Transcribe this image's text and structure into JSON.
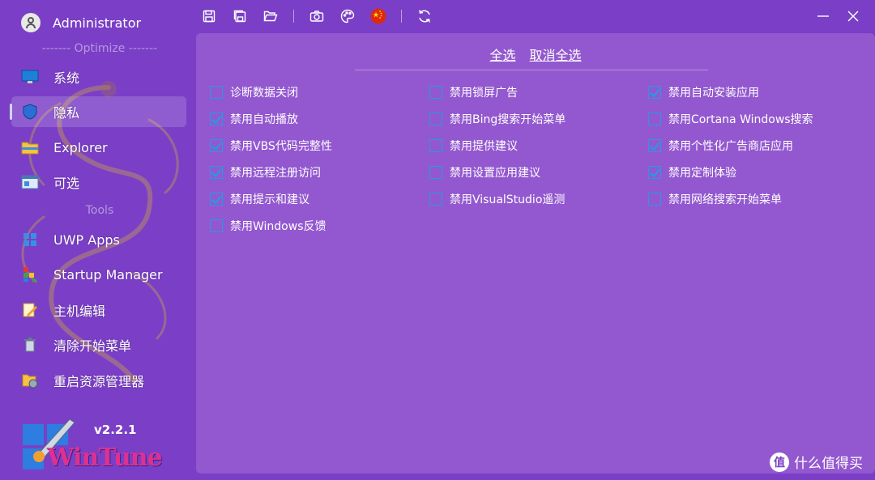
{
  "user": {
    "name": "Administrator"
  },
  "sections": {
    "optimize": "------- Optimize -------",
    "tools": "Tools"
  },
  "nav": [
    {
      "label": "系统",
      "icon": "monitor-icon"
    },
    {
      "label": "隐私",
      "icon": "shield-icon",
      "active": true
    },
    {
      "label": "Explorer",
      "icon": "folder-icon"
    },
    {
      "label": "可选",
      "icon": "window-icon"
    },
    {
      "label": "UWP Apps",
      "icon": "windows-icon"
    },
    {
      "label": "Startup Manager",
      "icon": "startup-icon"
    },
    {
      "label": "主机编辑",
      "icon": "edit-icon"
    },
    {
      "label": "清除开始菜单",
      "icon": "bin-icon"
    },
    {
      "label": "重启资源管理器",
      "icon": "restart-icon"
    }
  ],
  "brand": {
    "name": "WinTune",
    "version": "v2.2.1"
  },
  "toolbar": {
    "icons": [
      "save-icon",
      "save-as-icon",
      "open-folder-icon",
      "camera-icon",
      "palette-icon",
      "china-flag-icon",
      "refresh-icon"
    ]
  },
  "select": {
    "all": "全选",
    "none": "取消全选"
  },
  "checkboxes": [
    [
      {
        "label": "诊断数据关闭",
        "checked": false
      },
      {
        "label": "禁用自动播放",
        "checked": true
      },
      {
        "label": "禁用VBS代码完整性",
        "checked": true
      },
      {
        "label": "禁用远程注册访问",
        "checked": true
      },
      {
        "label": "禁用提示和建议",
        "checked": true
      },
      {
        "label": "禁用Windows反馈",
        "checked": false
      }
    ],
    [
      {
        "label": "禁用锁屏广告",
        "checked": false
      },
      {
        "label": "禁用Bing搜索开始菜单",
        "checked": false
      },
      {
        "label": "禁用提供建议",
        "checked": false
      },
      {
        "label": "禁用设置应用建议",
        "checked": false
      },
      {
        "label": "禁用VisualStudio遥测",
        "checked": false
      }
    ],
    [
      {
        "label": "禁用自动安装应用",
        "checked": true
      },
      {
        "label": "禁用Cortana Windows搜索",
        "checked": false
      },
      {
        "label": "禁用个性化广告商店应用",
        "checked": true
      },
      {
        "label": "禁用定制体验",
        "checked": true
      },
      {
        "label": "禁用网络搜索开始菜单",
        "checked": false
      }
    ]
  ],
  "watermark": {
    "icon_text": "值",
    "text": "什么值得买"
  },
  "colors": {
    "background": "#7a3fc6",
    "panel": "#9358cf",
    "checkbox": "#1f9de6",
    "brand": "#e0308f"
  }
}
